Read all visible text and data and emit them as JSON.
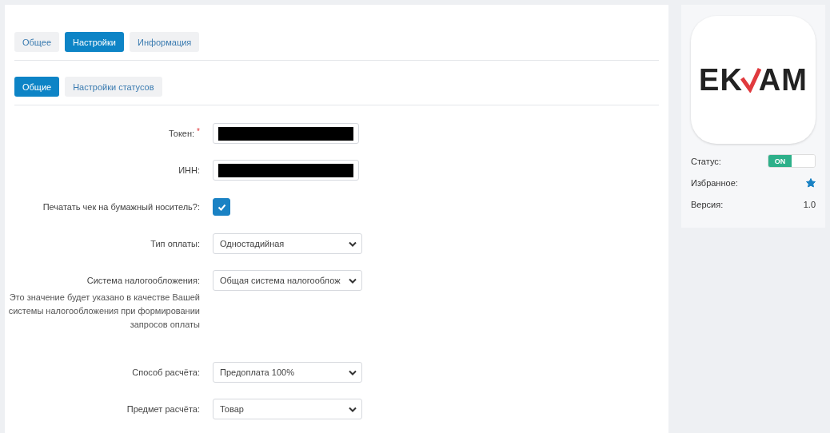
{
  "tabs": [
    {
      "label": "Общее",
      "selected": false
    },
    {
      "label": "Настройки",
      "selected": true
    },
    {
      "label": "Информация",
      "selected": false
    }
  ],
  "subtabs": [
    {
      "label": "Общие",
      "selected": true
    },
    {
      "label": "Настройки статусов",
      "selected": false
    }
  ],
  "fields": [
    {
      "kind": "text",
      "label": "Токен:",
      "required": true,
      "required_mark": "*",
      "value_hidden": true
    },
    {
      "kind": "text",
      "label": "ИНН:",
      "required": false,
      "value_hidden": true
    },
    {
      "kind": "checkbox",
      "label": "Печатать чек на бумажный носитель?:",
      "checked": true
    },
    {
      "kind": "select",
      "label": "Тип оплаты:",
      "value": "Одностадийная"
    },
    {
      "kind": "select",
      "label": "Система налогообложения:",
      "value": "Общая система налогооблож",
      "help": "Это значение будет указано в качестве Вашей системы налогообложения при формировании запросов оплаты"
    },
    {
      "kind": "select",
      "label": "Способ расчёта:",
      "value": "Предоплата 100%"
    },
    {
      "kind": "select",
      "label": "Предмет расчёта:",
      "value": "Товар"
    }
  ],
  "app": {
    "logo": [
      "EK",
      "AM"
    ],
    "properties": [
      {
        "kind": "toggle",
        "label": "Статус:",
        "on": true,
        "text": "ON"
      },
      {
        "kind": "favorite",
        "label": "Избранное:",
        "on": true
      },
      {
        "kind": "text",
        "label": "Версия:",
        "value": "1.0"
      }
    ]
  }
}
